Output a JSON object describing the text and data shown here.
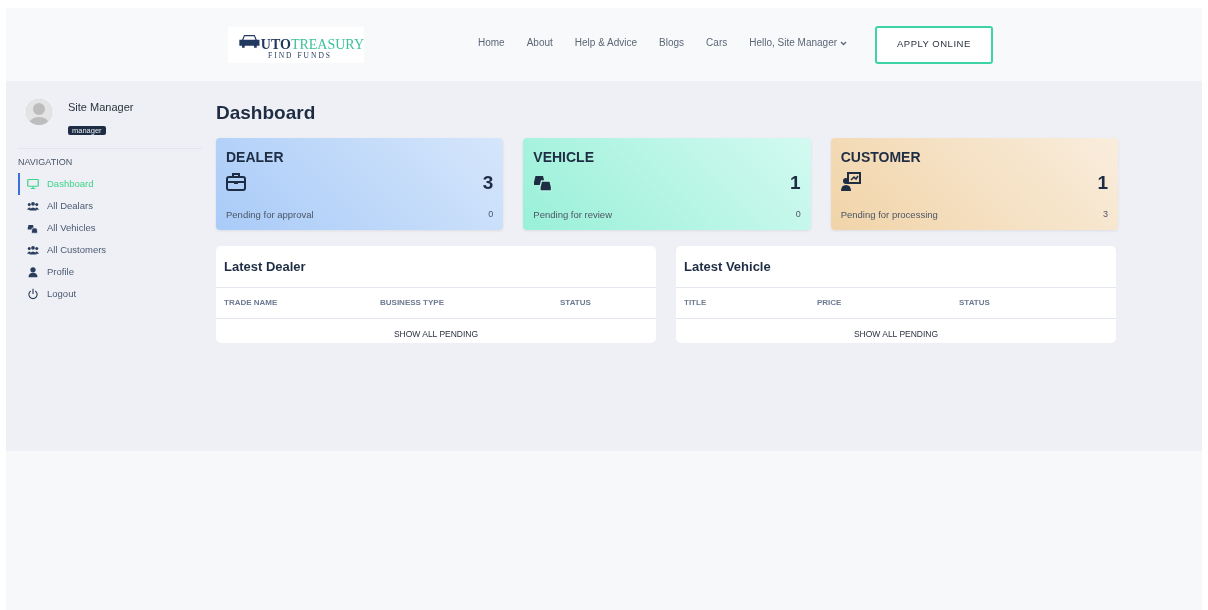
{
  "header": {
    "logo": {
      "main": "UTO",
      "accent": "TREASURY",
      "tagline": "FIND FUNDS"
    },
    "nav": [
      {
        "label": "Home",
        "kind": "link"
      },
      {
        "label": "About",
        "kind": "link"
      },
      {
        "label": "Help & Advice",
        "kind": "link"
      },
      {
        "label": "Blogs",
        "kind": "link"
      },
      {
        "label": "Cars",
        "kind": "link"
      },
      {
        "label": "Hello, Site Manager",
        "kind": "dropdown"
      }
    ],
    "cta": "APPLY ONLINE"
  },
  "sidebar": {
    "user": {
      "name": "Site Manager",
      "role": "manager"
    },
    "section": "NAVIGATION",
    "items": [
      {
        "label": "Dashboard",
        "selected": true
      },
      {
        "label": "All Dealars",
        "selected": false
      },
      {
        "label": "All Vehicles",
        "selected": false
      },
      {
        "label": "All Customers",
        "selected": false
      },
      {
        "label": "Profile",
        "selected": false
      },
      {
        "label": "Logout",
        "selected": false
      }
    ]
  },
  "page_title": "Dashboard",
  "stats": [
    {
      "kind": "dealer",
      "title": "DEALER",
      "count": "3",
      "caption": "Pending for approval",
      "sub_count": "0"
    },
    {
      "kind": "vehicle",
      "title": "VEHICLE",
      "count": "1",
      "caption": "Pending for review",
      "sub_count": "0"
    },
    {
      "kind": "customer",
      "title": "CUSTOMER",
      "count": "1",
      "caption": "Pending for processing",
      "sub_count": "3"
    }
  ],
  "panels": [
    {
      "title": "Latest Dealer",
      "columns": [
        "TRADE NAME",
        "BUSINESS TYPE",
        "STATUS"
      ],
      "footer": "SHOW ALL PENDING"
    },
    {
      "title": "Latest Vehicle",
      "columns": [
        "TITLE",
        "PRICE",
        "STATUS"
      ],
      "footer": "SHOW ALL PENDING"
    }
  ]
}
